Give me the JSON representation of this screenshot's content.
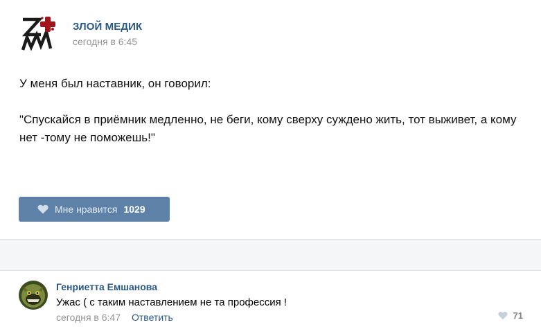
{
  "post": {
    "author": "ЗЛОЙ МЕДИК",
    "date": "сегодня в 6:45",
    "avatar_icon": "logo-zm",
    "text_line1": "У меня был наставник, он говорил:",
    "text_quote": "\"Спускайся в приёмник медленно, не беги, кому сверху суждено жить, тот выживет, а кому нет -тому не поможешь!\"",
    "like_label": "Мне нравится",
    "like_count": "1029",
    "like_icon": "heart-icon"
  },
  "comment": {
    "author": "Генриетта Емшанова",
    "text": "Ужас ( с таким наставлением не та профессия !",
    "date": "сегодня в 6:47",
    "reply_label": "Ответить",
    "like_count": "71",
    "like_icon": "heart-icon"
  },
  "colors": {
    "accent": "#2a5885",
    "like_button": "#5e81a8",
    "muted": "#939393",
    "band": "#f5f6f8"
  }
}
